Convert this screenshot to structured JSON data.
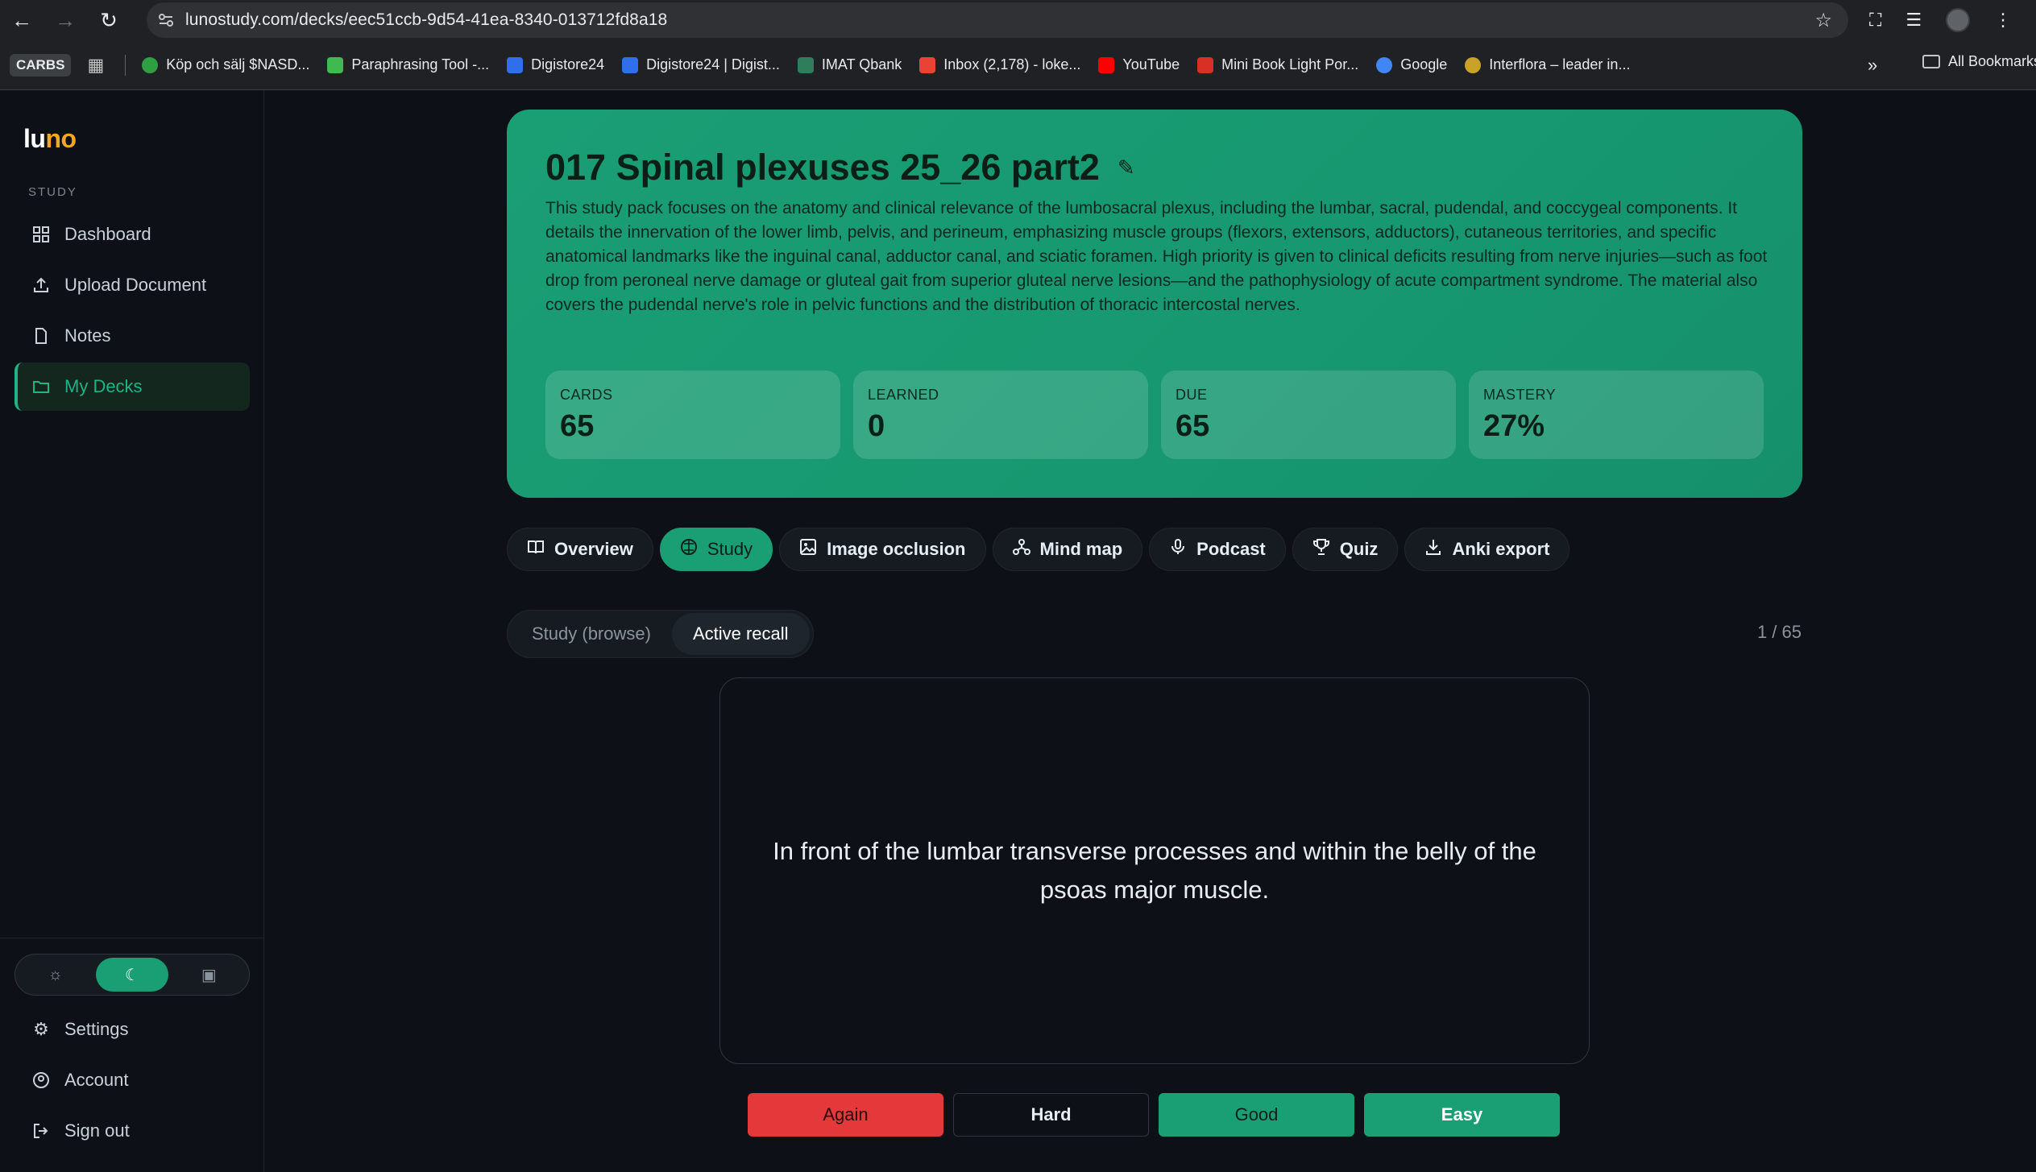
{
  "browser": {
    "url": "lunostudy.com/decks/eec51ccb-9d54-41ea-8340-013712fd8a18",
    "bookmarks_badge": "CARBS",
    "bookmarks": [
      {
        "label": "Köp och sälj $NASD...",
        "color": "#2ea043"
      },
      {
        "label": "Paraphrasing Tool -...",
        "color": "#3fb950"
      },
      {
        "label": "Digistore24",
        "color": "#2f6feb"
      },
      {
        "label": "Digistore24 | Digist...",
        "color": "#2f6feb"
      },
      {
        "label": "IMAT Qbank",
        "color": "#2e7d5b"
      },
      {
        "label": "Inbox (2,178) - loke...",
        "color": "#ea4335"
      },
      {
        "label": "YouTube",
        "color": "#ff0000"
      },
      {
        "label": "Mini Book Light Por...",
        "color": "#d93025"
      },
      {
        "label": "Google",
        "color": "#4285f4"
      },
      {
        "label": "Interflora – leader in...",
        "color": "#c9a227"
      }
    ],
    "all_bookmarks_label": "All Bookmarks"
  },
  "sidebar": {
    "logo_a": "lu",
    "logo_b": "no",
    "section_label": "STUDY",
    "items": [
      {
        "label": "Dashboard",
        "icon": "dashboard-icon"
      },
      {
        "label": "Upload Document",
        "icon": "upload-icon"
      },
      {
        "label": "Notes",
        "icon": "notes-icon"
      },
      {
        "label": "My Decks",
        "icon": "folder-icon",
        "active": true
      }
    ],
    "bottom_items": [
      {
        "label": "Settings",
        "icon": "gear-icon"
      },
      {
        "label": "Account",
        "icon": "account-icon"
      },
      {
        "label": "Sign out",
        "icon": "sign-out-icon"
      }
    ],
    "theme_selected": "dark"
  },
  "deck": {
    "title": "017 Spinal plexuses 25_26 part2",
    "description": "This study pack focuses on the anatomy and clinical relevance of the lumbosacral plexus, including the lumbar, sacral, pudendal, and coccygeal components. It details the innervation of the lower limb, pelvis, and perineum, emphasizing muscle groups (flexors, extensors, adductors), cutaneous territories, and specific anatomical landmarks like the inguinal canal, adductor canal, and sciatic foramen. High priority is given to clinical deficits resulting from nerve injuries—such as foot drop from peroneal nerve damage or gluteal gait from superior gluteal nerve lesions—and the pathophysiology of acute compartment syndrome. The material also covers the pudendal nerve's role in pelvic functions and the distribution of thoracic intercostal nerves.",
    "stats": [
      {
        "label": "CARDS",
        "value": "65"
      },
      {
        "label": "LEARNED",
        "value": "0"
      },
      {
        "label": "DUE",
        "value": "65"
      },
      {
        "label": "MASTERY",
        "value": "27%"
      }
    ]
  },
  "tabs": [
    {
      "label": "Overview",
      "icon": "book-icon"
    },
    {
      "label": "Study",
      "icon": "brain-icon",
      "active": true
    },
    {
      "label": "Image occlusion",
      "icon": "image-icon"
    },
    {
      "label": "Mind map",
      "icon": "mind-map-icon"
    },
    {
      "label": "Podcast",
      "icon": "microphone-icon"
    },
    {
      "label": "Quiz",
      "icon": "trophy-icon"
    },
    {
      "label": "Anki export",
      "icon": "download-icon"
    }
  ],
  "study_mode": {
    "options": [
      "Study (browse)",
      "Active recall"
    ],
    "selected": "Active recall",
    "counter": "1 / 65"
  },
  "card": {
    "text": "In front of the lumbar transverse processes and within the belly of the psoas major muscle."
  },
  "grades": {
    "again": "Again",
    "hard": "Hard",
    "good": "Good",
    "easy": "Easy"
  }
}
